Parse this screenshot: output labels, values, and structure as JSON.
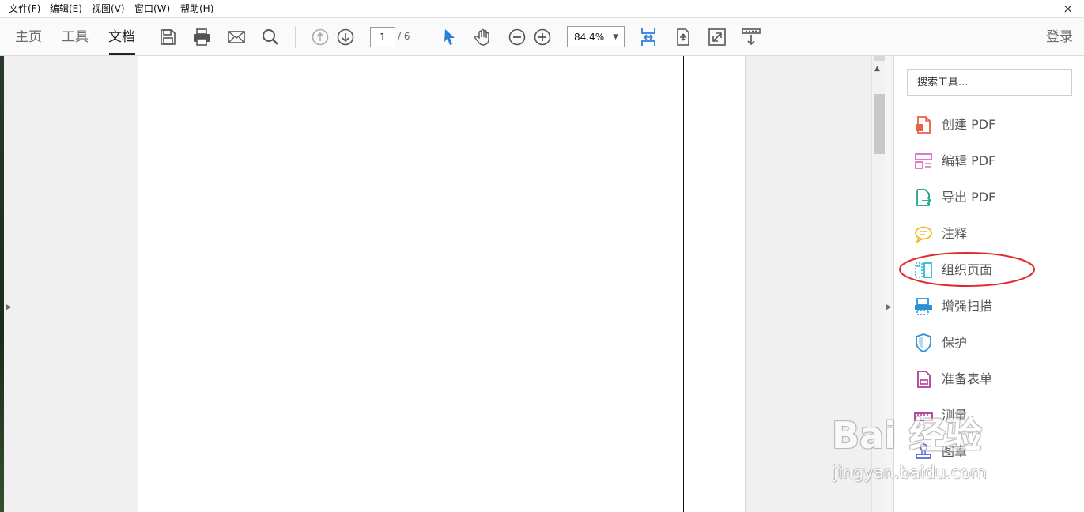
{
  "menubar": {
    "items": [
      "文件(F)",
      "编辑(E)",
      "视图(V)",
      "窗口(W)",
      "帮助(H)"
    ],
    "close_glyph": "×"
  },
  "toolbar": {
    "tabs": [
      "主页",
      "工具",
      "文档"
    ],
    "active_tab": "文档",
    "page_current": "1",
    "page_total": "/ 6",
    "zoom": "84.4%",
    "zoom_arrow": "▼",
    "login": "登录",
    "icons": [
      "save-icon",
      "print-icon",
      "email-icon",
      "search-icon",
      "prev-page-icon",
      "next-page-icon",
      "select-arrow-icon",
      "hand-icon",
      "zoom-out-icon",
      "zoom-in-icon",
      "fit-page-icon",
      "scroll-mode-icon",
      "full-screen-icon",
      "read-mode-icon"
    ]
  },
  "panels": {
    "left_toggle_glyph": "▶",
    "right_toggle_glyph": "▶",
    "scroll_up_glyph": "▲"
  },
  "tools_pane": {
    "search_placeholder": "搜索工具...",
    "items": [
      {
        "label": "创建 PDF",
        "icon": "create-pdf-icon",
        "color": "#e8604c"
      },
      {
        "label": "编辑 PDF",
        "icon": "edit-pdf-icon",
        "color": "#e066c8"
      },
      {
        "label": "导出 PDF",
        "icon": "export-pdf-icon",
        "color": "#1aa687"
      },
      {
        "label": "注释",
        "icon": "comment-icon",
        "color": "#f2b81d"
      },
      {
        "label": "组织页面",
        "icon": "organize-pages-icon",
        "color": "#2ab8d6"
      },
      {
        "label": "增强扫描",
        "icon": "enhance-scan-icon",
        "color": "#2b8fd8"
      },
      {
        "label": "保护",
        "icon": "shield-icon",
        "color": "#2f8fd8"
      },
      {
        "label": "准备表单",
        "icon": "prepare-form-icon",
        "color": "#b0399a"
      },
      {
        "label": "测量",
        "icon": "measure-icon",
        "color": "#b0399a"
      },
      {
        "label": "图章",
        "icon": "stamp-icon",
        "color": "#5a6ad8"
      }
    ]
  },
  "annotation": {
    "color": "#e02a2a"
  },
  "watermark": {
    "brand": "Bai 经验",
    "url": "jingyan.baidu.com"
  },
  "colors": {
    "accent": "#2b7fd8",
    "toolbar_icon": "#555555"
  }
}
